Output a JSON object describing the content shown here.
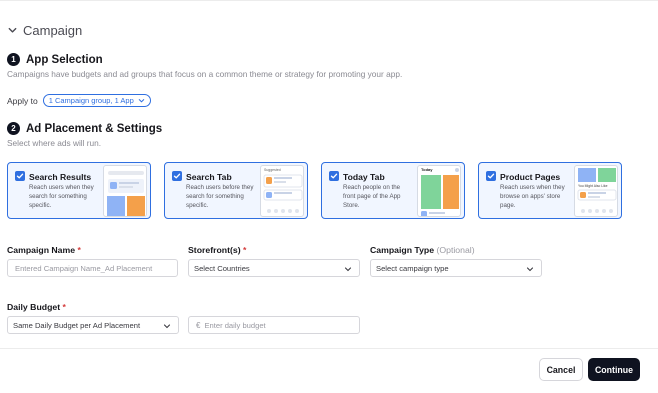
{
  "header": {
    "title": "Campaign"
  },
  "steps": [
    {
      "number": "1",
      "title": "App Selection",
      "description": "Campaigns have budgets and ad groups that focus on a common theme or strategy for promoting your app."
    },
    {
      "number": "2",
      "title": "Ad Placement & Settings",
      "description": "Select where ads will run."
    }
  ],
  "apply": {
    "label": "Apply to",
    "value": "1 Campaign group, 1 App"
  },
  "placements": [
    {
      "title": "Search Results",
      "description": "Reach users when they search for something specific.",
      "checked": true
    },
    {
      "title": "Search Tab",
      "description": "Reach users before they search for something specific.",
      "checked": true,
      "thumb_caption": "Suggested"
    },
    {
      "title": "Today Tab",
      "description": "Reach people on the front page of the App Store.",
      "checked": true,
      "thumb_caption": "Today"
    },
    {
      "title": "Product Pages",
      "description": "Reach users when they browse on apps' store page.",
      "checked": true,
      "thumb_caption": "You Might Also Like"
    }
  ],
  "form": {
    "campaign_name": {
      "label": "Campaign Name",
      "required": "*",
      "placeholder": "Entered Campaign Name_Ad Placement"
    },
    "storefronts": {
      "label": "Storefront(s)",
      "required": "*",
      "value": "Select Countries"
    },
    "campaign_type": {
      "label": "Campaign Type",
      "optional": "(Optional)",
      "value": "Select campaign type"
    },
    "daily_budget": {
      "label": "Daily Budget",
      "required": "*",
      "mode": "Same Daily Budget per Ad Placement",
      "currency": "€",
      "placeholder": "Enter daily budget"
    }
  },
  "actions": {
    "cancel": "Cancel",
    "continue": "Continue"
  },
  "colors": {
    "accent": "#2f6fe0",
    "dark": "#0f1320",
    "card_bg": "#f1f6ff",
    "required": "#d43c3c",
    "thumb_blue": "#8fb3f5",
    "thumb_green": "#7fd49a",
    "thumb_orange": "#f4a04a"
  }
}
